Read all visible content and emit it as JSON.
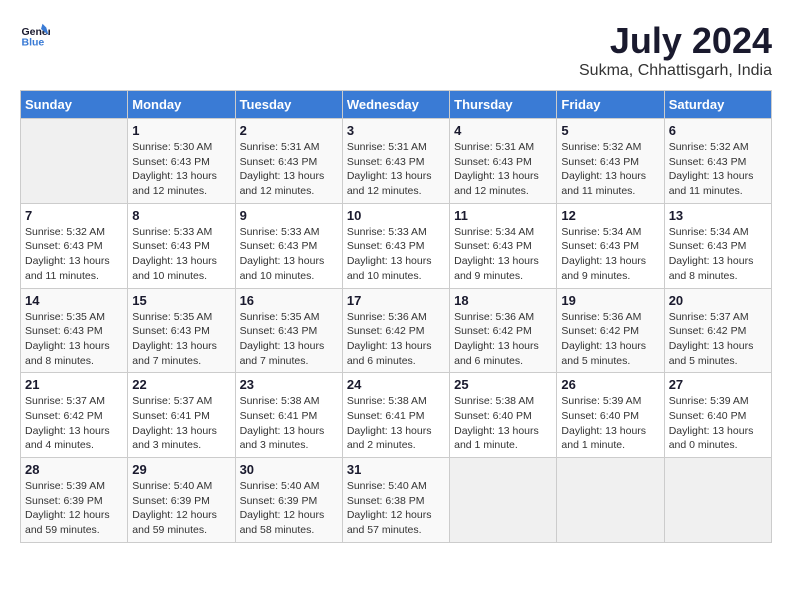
{
  "logo": {
    "line1": "General",
    "line2": "Blue"
  },
  "title": "July 2024",
  "location": "Sukma, Chhattisgarh, India",
  "days_header": [
    "Sunday",
    "Monday",
    "Tuesday",
    "Wednesday",
    "Thursday",
    "Friday",
    "Saturday"
  ],
  "weeks": [
    [
      {
        "day": "",
        "info": ""
      },
      {
        "day": "1",
        "info": "Sunrise: 5:30 AM\nSunset: 6:43 PM\nDaylight: 13 hours\nand 12 minutes."
      },
      {
        "day": "2",
        "info": "Sunrise: 5:31 AM\nSunset: 6:43 PM\nDaylight: 13 hours\nand 12 minutes."
      },
      {
        "day": "3",
        "info": "Sunrise: 5:31 AM\nSunset: 6:43 PM\nDaylight: 13 hours\nand 12 minutes."
      },
      {
        "day": "4",
        "info": "Sunrise: 5:31 AM\nSunset: 6:43 PM\nDaylight: 13 hours\nand 12 minutes."
      },
      {
        "day": "5",
        "info": "Sunrise: 5:32 AM\nSunset: 6:43 PM\nDaylight: 13 hours\nand 11 minutes."
      },
      {
        "day": "6",
        "info": "Sunrise: 5:32 AM\nSunset: 6:43 PM\nDaylight: 13 hours\nand 11 minutes."
      }
    ],
    [
      {
        "day": "7",
        "info": "Sunrise: 5:32 AM\nSunset: 6:43 PM\nDaylight: 13 hours\nand 11 minutes."
      },
      {
        "day": "8",
        "info": "Sunrise: 5:33 AM\nSunset: 6:43 PM\nDaylight: 13 hours\nand 10 minutes."
      },
      {
        "day": "9",
        "info": "Sunrise: 5:33 AM\nSunset: 6:43 PM\nDaylight: 13 hours\nand 10 minutes."
      },
      {
        "day": "10",
        "info": "Sunrise: 5:33 AM\nSunset: 6:43 PM\nDaylight: 13 hours\nand 10 minutes."
      },
      {
        "day": "11",
        "info": "Sunrise: 5:34 AM\nSunset: 6:43 PM\nDaylight: 13 hours\nand 9 minutes."
      },
      {
        "day": "12",
        "info": "Sunrise: 5:34 AM\nSunset: 6:43 PM\nDaylight: 13 hours\nand 9 minutes."
      },
      {
        "day": "13",
        "info": "Sunrise: 5:34 AM\nSunset: 6:43 PM\nDaylight: 13 hours\nand 8 minutes."
      }
    ],
    [
      {
        "day": "14",
        "info": "Sunrise: 5:35 AM\nSunset: 6:43 PM\nDaylight: 13 hours\nand 8 minutes."
      },
      {
        "day": "15",
        "info": "Sunrise: 5:35 AM\nSunset: 6:43 PM\nDaylight: 13 hours\nand 7 minutes."
      },
      {
        "day": "16",
        "info": "Sunrise: 5:35 AM\nSunset: 6:43 PM\nDaylight: 13 hours\nand 7 minutes."
      },
      {
        "day": "17",
        "info": "Sunrise: 5:36 AM\nSunset: 6:42 PM\nDaylight: 13 hours\nand 6 minutes."
      },
      {
        "day": "18",
        "info": "Sunrise: 5:36 AM\nSunset: 6:42 PM\nDaylight: 13 hours\nand 6 minutes."
      },
      {
        "day": "19",
        "info": "Sunrise: 5:36 AM\nSunset: 6:42 PM\nDaylight: 13 hours\nand 5 minutes."
      },
      {
        "day": "20",
        "info": "Sunrise: 5:37 AM\nSunset: 6:42 PM\nDaylight: 13 hours\nand 5 minutes."
      }
    ],
    [
      {
        "day": "21",
        "info": "Sunrise: 5:37 AM\nSunset: 6:42 PM\nDaylight: 13 hours\nand 4 minutes."
      },
      {
        "day": "22",
        "info": "Sunrise: 5:37 AM\nSunset: 6:41 PM\nDaylight: 13 hours\nand 3 minutes."
      },
      {
        "day": "23",
        "info": "Sunrise: 5:38 AM\nSunset: 6:41 PM\nDaylight: 13 hours\nand 3 minutes."
      },
      {
        "day": "24",
        "info": "Sunrise: 5:38 AM\nSunset: 6:41 PM\nDaylight: 13 hours\nand 2 minutes."
      },
      {
        "day": "25",
        "info": "Sunrise: 5:38 AM\nSunset: 6:40 PM\nDaylight: 13 hours\nand 1 minute."
      },
      {
        "day": "26",
        "info": "Sunrise: 5:39 AM\nSunset: 6:40 PM\nDaylight: 13 hours\nand 1 minute."
      },
      {
        "day": "27",
        "info": "Sunrise: 5:39 AM\nSunset: 6:40 PM\nDaylight: 13 hours\nand 0 minutes."
      }
    ],
    [
      {
        "day": "28",
        "info": "Sunrise: 5:39 AM\nSunset: 6:39 PM\nDaylight: 12 hours\nand 59 minutes."
      },
      {
        "day": "29",
        "info": "Sunrise: 5:40 AM\nSunset: 6:39 PM\nDaylight: 12 hours\nand 59 minutes."
      },
      {
        "day": "30",
        "info": "Sunrise: 5:40 AM\nSunset: 6:39 PM\nDaylight: 12 hours\nand 58 minutes."
      },
      {
        "day": "31",
        "info": "Sunrise: 5:40 AM\nSunset: 6:38 PM\nDaylight: 12 hours\nand 57 minutes."
      },
      {
        "day": "",
        "info": ""
      },
      {
        "day": "",
        "info": ""
      },
      {
        "day": "",
        "info": ""
      }
    ]
  ]
}
